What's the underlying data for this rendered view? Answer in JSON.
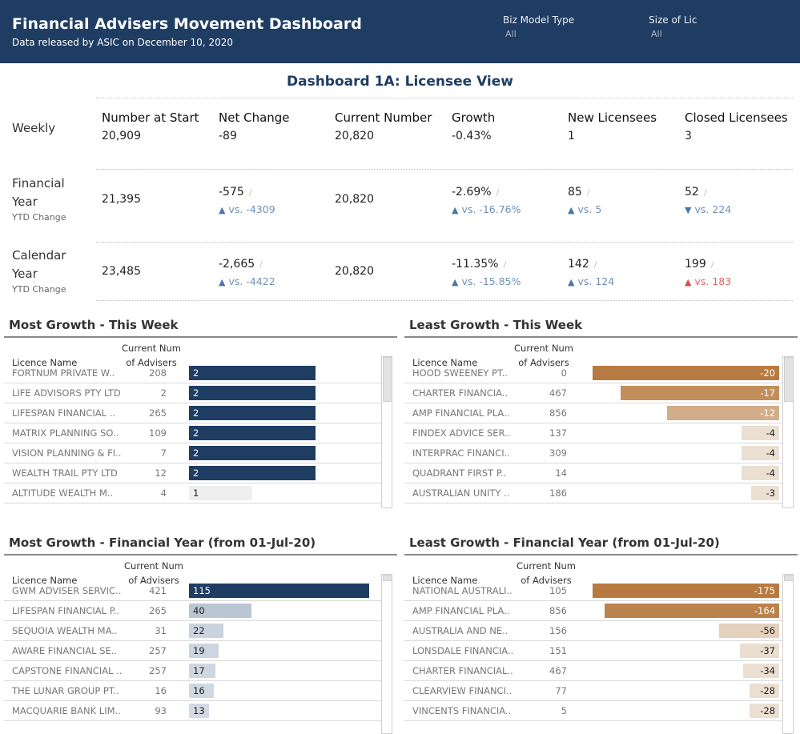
{
  "header": {
    "title": "Financial Advisers Movement Dashboard",
    "subtitle": "Data released by ASIC on December 10, 2020",
    "filters": [
      {
        "label": "Biz Model Type",
        "value": "All"
      },
      {
        "label": "Size of Lic",
        "value": "All"
      }
    ],
    "bg_color": "#1f3d63"
  },
  "dashboard_title": "Dashboard 1A: Licensee View",
  "metrics": {
    "columns": [
      "Number at Start",
      "Net Change",
      "Current Number",
      "Growth",
      "New Licensees",
      "Closed Licensees"
    ],
    "weekly": {
      "label": "Weekly",
      "values": [
        "20,909",
        "-89",
        "20,820",
        "-0.43%",
        "1",
        "3"
      ]
    },
    "financial_year": {
      "label_line1": "Financial",
      "label_line2": "Year",
      "sublabel": "YTD Change",
      "values": [
        "21,395",
        "-575",
        "20,820",
        "-2.69%",
        "85",
        "52"
      ],
      "comparisons": [
        "vs. -4309",
        "vs. -16.76%",
        "vs. 5",
        "vs. 224"
      ]
    },
    "calendar_year": {
      "label_line1": "Calendar",
      "label_line2": "Year",
      "sublabel": "YTD Change",
      "values": [
        "23,485",
        "-2,665",
        "20,820",
        "-11.35%",
        "142",
        "199"
      ],
      "comparisons": [
        "vs. -4422",
        "vs. -15.85%",
        "vs. 124",
        "vs. 183"
      ]
    },
    "slash": "/",
    "up_arrow": "▲",
    "down_arrow": "▼"
  },
  "panels": {
    "col_licence": "Licence Name",
    "col_current_1": "Current Num",
    "col_current_2": "of Advisers",
    "most_week": {
      "title": "Most Growth - This Week",
      "rows": [
        {
          "name": "FORTNUM PRIVATE W..",
          "current": "208",
          "change": 2
        },
        {
          "name": "LIFE ADVISORS PTY LTD",
          "current": "2",
          "change": 2
        },
        {
          "name": "LIFESPAN FINANCIAL ..",
          "current": "265",
          "change": 2
        },
        {
          "name": "MATRIX PLANNING SO..",
          "current": "109",
          "change": 2
        },
        {
          "name": "VISION PLANNING & FI..",
          "current": "7",
          "change": 2
        },
        {
          "name": "WEALTH TRAIL PTY LTD",
          "current": "12",
          "change": 2
        },
        {
          "name": "ALTITUDE WEALTH M..",
          "current": "4",
          "change": 1
        }
      ]
    },
    "least_week": {
      "title": "Least Growth - This Week",
      "rows": [
        {
          "name": "HOOD SWEENEY PT..",
          "current": "0",
          "change": -20
        },
        {
          "name": "CHARTER FINANCIA..",
          "current": "467",
          "change": -17
        },
        {
          "name": "AMP FINANCIAL PLA..",
          "current": "856",
          "change": -12
        },
        {
          "name": "FINDEX ADVICE SER..",
          "current": "137",
          "change": -4
        },
        {
          "name": "INTERPRAC FINANCI..",
          "current": "309",
          "change": -4
        },
        {
          "name": "QUADRANT FIRST P..",
          "current": "14",
          "change": -4
        },
        {
          "name": "AUSTRALIAN UNITY ..",
          "current": "186",
          "change": -3
        }
      ]
    },
    "most_fy": {
      "title": "Most Growth - Financial Year (from 01-Jul-20)",
      "rows": [
        {
          "name": "GWM ADVISER SERVIC..",
          "current": "421",
          "change": 115
        },
        {
          "name": "LIFESPAN FINANCIAL P..",
          "current": "265",
          "change": 40
        },
        {
          "name": "SEQUOIA WEALTH MA..",
          "current": "31",
          "change": 22
        },
        {
          "name": "AWARE FINANCIAL SE..",
          "current": "257",
          "change": 19
        },
        {
          "name": "CAPSTONE FINANCIAL ..",
          "current": "257",
          "change": 17
        },
        {
          "name": "THE LUNAR GROUP PT..",
          "current": "16",
          "change": 16
        },
        {
          "name": "MACQUARIE BANK LIM..",
          "current": "93",
          "change": 13
        }
      ]
    },
    "least_fy": {
      "title": "Least Growth - Financial Year (from 01-Jul-20)",
      "rows": [
        {
          "name": "NATIONAL AUSTRALI..",
          "current": "105",
          "change": -175
        },
        {
          "name": "AMP FINANCIAL PLA..",
          "current": "856",
          "change": -164
        },
        {
          "name": "AUSTRALIA AND NE..",
          "current": "156",
          "change": -56
        },
        {
          "name": "LONSDALE FINANCIA..",
          "current": "151",
          "change": -37
        },
        {
          "name": "CHARTER FINANCIAL..",
          "current": "467",
          "change": -34
        },
        {
          "name": "CLEARVIEW FINANCI..",
          "current": "77",
          "change": -28
        },
        {
          "name": "VINCENTS FINANCIA..",
          "current": "5",
          "change": -28
        }
      ]
    }
  },
  "colors": {
    "positive_dark": "#1f3d63",
    "negative_dark": "#b77b41",
    "arrow_up": "#4a76a8",
    "arrow_down_red": "#e04848"
  }
}
